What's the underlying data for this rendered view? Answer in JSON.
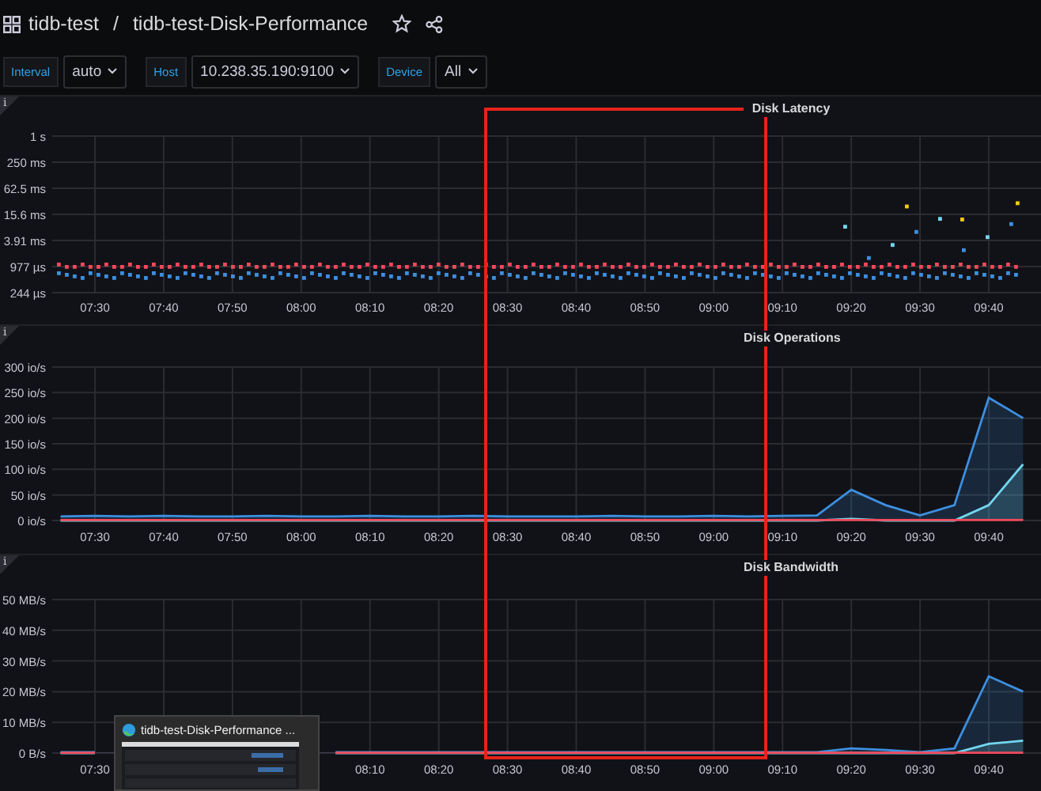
{
  "header": {
    "folder": "tidb-test",
    "separator": "/",
    "dashboard": "tidb-test-Disk-Performance"
  },
  "variables": [
    {
      "label": "Interval",
      "value": "auto"
    },
    {
      "label": "Host",
      "value": "10.238.35.190:9100"
    },
    {
      "label": "Device",
      "value": "All"
    }
  ],
  "panels": [
    {
      "kind": "scatter",
      "info": "i",
      "title": "Disk Latency",
      "y_labels": [
        "1 s",
        "250 ms",
        "62.5 ms",
        "15.6 ms",
        "3.91 ms",
        "977 µs",
        "244 µs"
      ],
      "x_labels": [
        "07:30",
        "07:40",
        "07:50",
        "08:00",
        "08:10",
        "08:20",
        "08:30",
        "08:40",
        "08:50",
        "09:00",
        "09:10",
        "09:20",
        "09:30",
        "09:40"
      ]
    },
    {
      "kind": "chart",
      "info": "i",
      "chart_data": {
        "type": "area",
        "title": "Disk Operations",
        "grid": true,
        "categories": [
          null,
          "07:30",
          null,
          "07:40",
          null,
          "07:50",
          null,
          "08:00",
          null,
          "08:10",
          null,
          "08:20",
          null,
          "08:30",
          null,
          "08:40",
          null,
          "08:50",
          null,
          "09:00",
          null,
          "09:10",
          null,
          "09:20",
          null,
          "09:30",
          null,
          "09:40",
          null
        ],
        "ylim": [
          0,
          300
        ],
        "yticks": [
          {
            "value": 0,
            "label": "0 io/s"
          },
          {
            "value": 50,
            "label": "50 io/s"
          },
          {
            "value": 100,
            "label": "100 io/s"
          },
          {
            "value": 150,
            "label": "150 io/s"
          },
          {
            "value": 200,
            "label": "200 io/s"
          },
          {
            "value": 250,
            "label": "250 io/s"
          },
          {
            "value": 300,
            "label": "300 io/s"
          }
        ],
        "series": [
          {
            "color": "#3d8fe0",
            "values": [
              8,
              9,
              8,
              9,
              8,
              8,
              9,
              8,
              8,
              9,
              8,
              8,
              9,
              8,
              8,
              8,
              9,
              8,
              8,
              9,
              8,
              9,
              10,
              60,
              30,
              10,
              30,
              240,
              200
            ]
          },
          {
            "color": "#73d7f0",
            "values": [
              0,
              0,
              0,
              0,
              0,
              0,
              0,
              0,
              0,
              0,
              0,
              0,
              0,
              0,
              0,
              0,
              0,
              0,
              0,
              0,
              0,
              0,
              0,
              3,
              0,
              0,
              0,
              30,
              110
            ]
          },
          {
            "color": "#f2495c",
            "values": [
              1,
              1,
              1,
              1,
              1,
              1,
              1,
              1,
              1,
              1,
              1,
              1,
              1,
              1,
              1,
              1,
              1,
              1,
              1,
              1,
              1,
              1,
              1,
              1,
              1,
              1,
              1,
              1,
              1
            ]
          }
        ]
      }
    },
    {
      "kind": "chart",
      "info": "i",
      "chart_data": {
        "type": "area",
        "title": "Disk Bandwidth",
        "grid": true,
        "categories": [
          null,
          "07:30",
          null,
          null,
          null,
          null,
          null,
          null,
          null,
          "08:10",
          null,
          "08:20",
          null,
          "08:30",
          null,
          "08:40",
          null,
          "08:50",
          null,
          "09:00",
          null,
          "09:10",
          null,
          "09:20",
          null,
          "09:30",
          null,
          "09:40",
          null
        ],
        "ylim": [
          0,
          50
        ],
        "yticks": [
          {
            "value": 0,
            "label": "0 B/s"
          },
          {
            "value": 10,
            "label": "10 MB/s"
          },
          {
            "value": 20,
            "label": "20 MB/s"
          },
          {
            "value": 30,
            "label": "30 MB/s"
          },
          {
            "value": 40,
            "label": "40 MB/s"
          },
          {
            "value": 50,
            "label": "50 MB/s"
          }
        ],
        "series": [
          {
            "color": "#3d8fe0",
            "values": [
              0.3,
              0.3,
              null,
              null,
              null,
              null,
              null,
              null,
              0.3,
              0.3,
              0.3,
              0.3,
              0.3,
              0.3,
              0.3,
              0.3,
              0.3,
              0.3,
              0.3,
              0.3,
              0.3,
              0.3,
              0.3,
              1.5,
              1,
              0.3,
              1.5,
              25,
              20
            ]
          },
          {
            "color": "#73d7f0",
            "values": [
              0,
              0,
              null,
              null,
              null,
              null,
              null,
              null,
              0,
              0,
              0,
              0,
              0,
              0,
              0,
              0,
              0,
              0,
              0,
              0,
              0,
              0,
              0,
              0,
              0,
              0,
              0,
              3,
              4
            ]
          },
          {
            "color": "#f2495c",
            "values": [
              0.1,
              0.1,
              null,
              null,
              null,
              null,
              null,
              null,
              0.1,
              0.1,
              0.1,
              0.1,
              0.1,
              0.1,
              0.1,
              0.1,
              0.1,
              0.1,
              0.1,
              0.1,
              0.1,
              0.1,
              0.1,
              0.1,
              0.1,
              0.1,
              0.1,
              0.1,
              0.1
            ]
          }
        ]
      }
    }
  ],
  "highlight": {
    "kind": "rectangle",
    "color": "#e8221b"
  },
  "window_preview": {
    "title": "tidb-test-Disk-Performance ..."
  }
}
